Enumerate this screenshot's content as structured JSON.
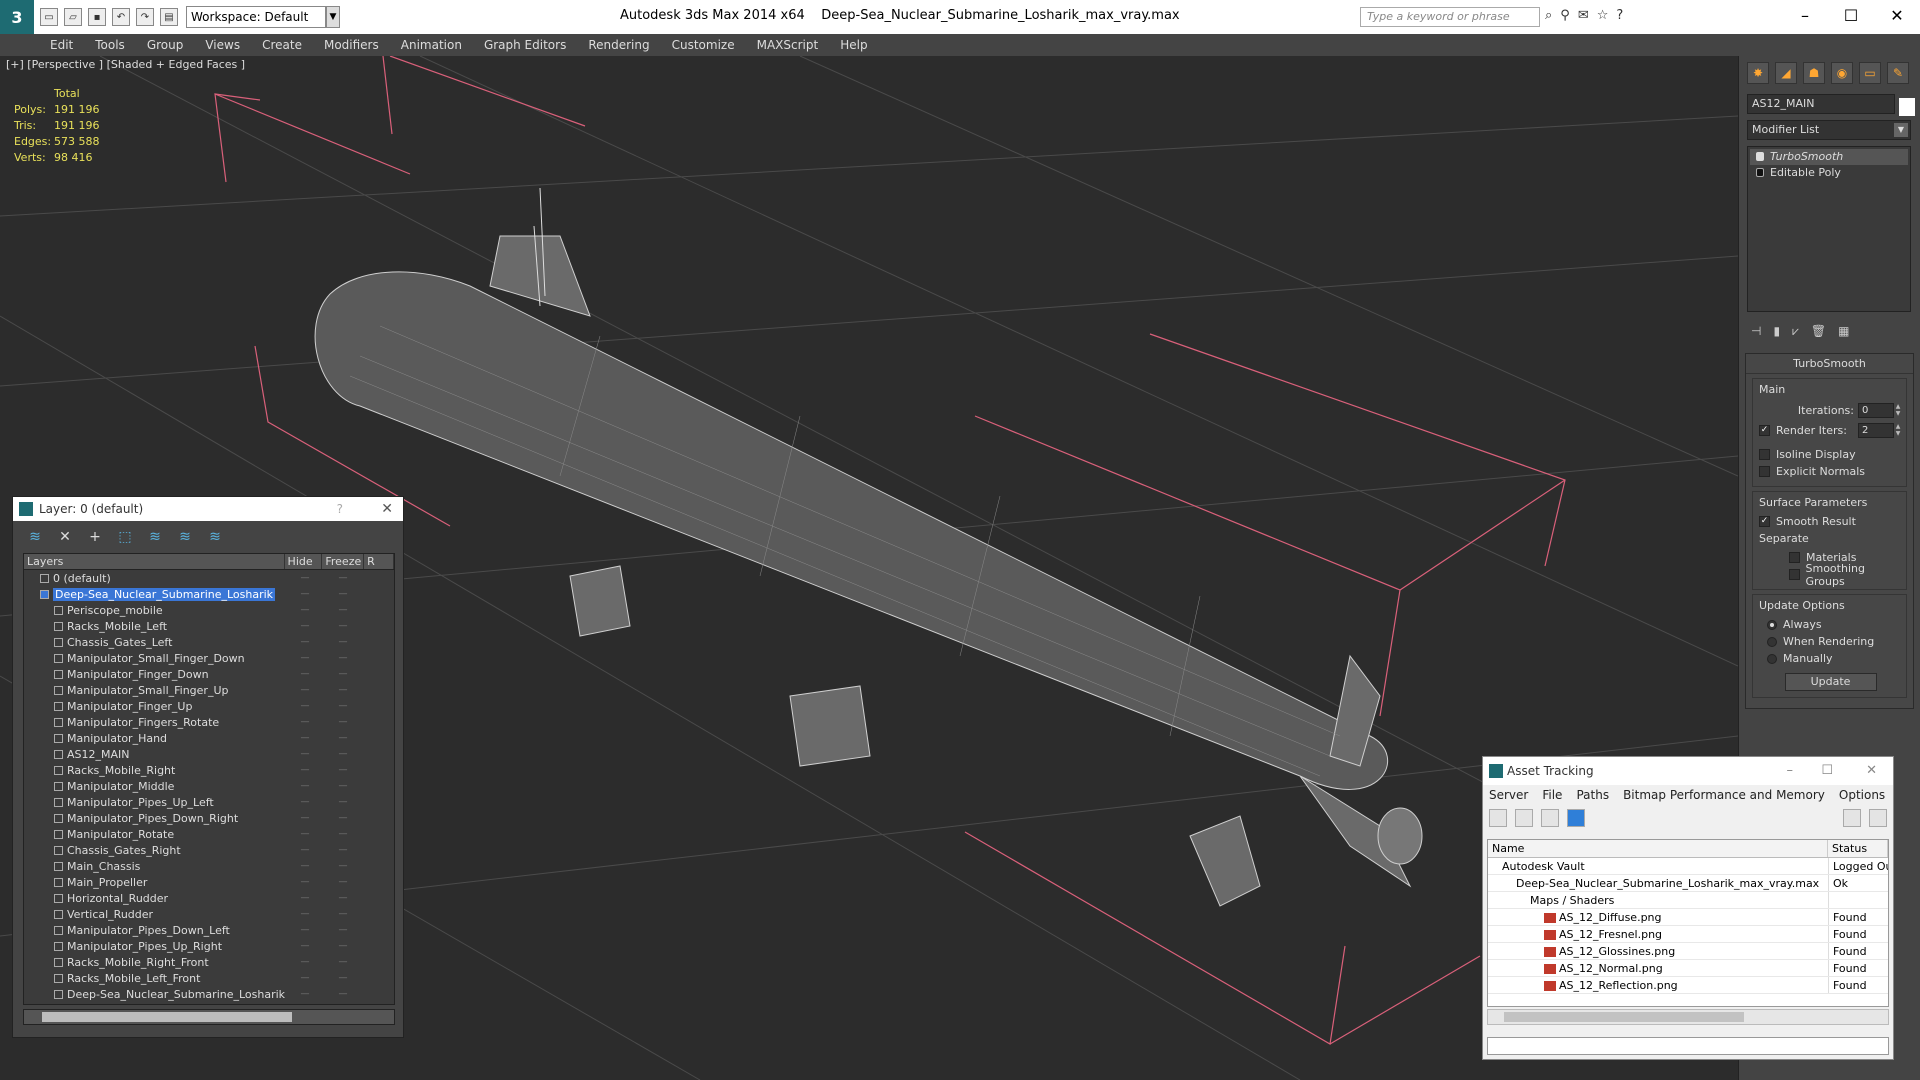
{
  "titlebar": {
    "workspace": "Workspace: Default",
    "app_title": "Autodesk 3ds Max  2014 x64",
    "file_title": "Deep-Sea_Nuclear_Submarine_Losharik_max_vray.max",
    "search_placeholder": "Type a keyword or phrase"
  },
  "menu": [
    "Edit",
    "Tools",
    "Group",
    "Views",
    "Create",
    "Modifiers",
    "Animation",
    "Graph Editors",
    "Rendering",
    "Customize",
    "MAXScript",
    "Help"
  ],
  "viewport": {
    "label": "[+] [Perspective ] [Shaded + Edged Faces ]",
    "stats_header": "Total",
    "stats": [
      {
        "k": "Polys:",
        "v": "191 196"
      },
      {
        "k": "Tris:",
        "v": "191 196"
      },
      {
        "k": "Edges:",
        "v": "573 588"
      },
      {
        "k": "Verts:",
        "v": "98 416"
      }
    ]
  },
  "cmdpanel": {
    "object_name": "AS12_MAIN",
    "modifier_list": "Modifier List",
    "stack": [
      "TurboSmooth",
      "Editable Poly"
    ],
    "turbosmooth": {
      "title": "TurboSmooth",
      "main": "Main",
      "iterations_label": "Iterations:",
      "iterations": "0",
      "render_iters_label": "Render Iters:",
      "render_iters": "2",
      "isoline": "Isoline Display",
      "explicit_normals": "Explicit Normals",
      "surface_params": "Surface Parameters",
      "smooth_result": "Smooth Result",
      "separate": "Separate",
      "materials": "Materials",
      "smoothing_groups": "Smoothing Groups",
      "update_options": "Update Options",
      "always": "Always",
      "when_rendering": "When Rendering",
      "manually": "Manually",
      "update_btn": "Update"
    }
  },
  "layer_dialog": {
    "title": "Layer: 0 (default)",
    "help": "?",
    "col_layers": "Layers",
    "col_hide": "Hide",
    "col_freeze": "Freeze",
    "col_r": "R",
    "rows": [
      {
        "name": "0 (default)",
        "level": 1
      },
      {
        "name": "Deep-Sea_Nuclear_Submarine_Losharik",
        "level": 1
      },
      {
        "name": "Periscope_mobile",
        "level": 2
      },
      {
        "name": "Racks_Mobile_Left",
        "level": 2
      },
      {
        "name": "Chassis_Gates_Left",
        "level": 2
      },
      {
        "name": "Manipulator_Small_Finger_Down",
        "level": 2
      },
      {
        "name": "Manipulator_Finger_Down",
        "level": 2
      },
      {
        "name": "Manipulator_Small_Finger_Up",
        "level": 2
      },
      {
        "name": "Manipulator_Finger_Up",
        "level": 2
      },
      {
        "name": "Manipulator_Fingers_Rotate",
        "level": 2
      },
      {
        "name": "Manipulator_Hand",
        "level": 2
      },
      {
        "name": "AS12_MAIN",
        "level": 2
      },
      {
        "name": "Racks_Mobile_Right",
        "level": 2
      },
      {
        "name": "Manipulator_Middle",
        "level": 2
      },
      {
        "name": "Manipulator_Pipes_Up_Left",
        "level": 2
      },
      {
        "name": "Manipulator_Pipes_Down_Right",
        "level": 2
      },
      {
        "name": "Manipulator_Rotate",
        "level": 2
      },
      {
        "name": "Chassis_Gates_Right",
        "level": 2
      },
      {
        "name": "Main_Chassis",
        "level": 2
      },
      {
        "name": "Main_Propeller",
        "level": 2
      },
      {
        "name": "Horizontal_Rudder",
        "level": 2
      },
      {
        "name": "Vertical_Rudder",
        "level": 2
      },
      {
        "name": "Manipulator_Pipes_Down_Left",
        "level": 2
      },
      {
        "name": "Manipulator_Pipes_Up_Right",
        "level": 2
      },
      {
        "name": "Racks_Mobile_Right_Front",
        "level": 2
      },
      {
        "name": "Racks_Mobile_Left_Front",
        "level": 2
      },
      {
        "name": "Deep-Sea_Nuclear_Submarine_Losharik",
        "level": 2
      }
    ]
  },
  "asset_tracking": {
    "title": "Asset Tracking",
    "menu": [
      "Server",
      "File",
      "Paths",
      "Bitmap Performance and Memory",
      "Options"
    ],
    "col_name": "Name",
    "col_status": "Status",
    "rows": [
      {
        "name": "Autodesk Vault",
        "status": "Logged Out",
        "level": 1
      },
      {
        "name": "Deep-Sea_Nuclear_Submarine_Losharik_max_vray.max",
        "status": "Ok",
        "level": 2
      },
      {
        "name": "Maps / Shaders",
        "status": "",
        "level": 3
      },
      {
        "name": "AS_12_Diffuse.png",
        "status": "Found",
        "level": 4
      },
      {
        "name": "AS_12_Fresnel.png",
        "status": "Found",
        "level": 4
      },
      {
        "name": "AS_12_Glossines.png",
        "status": "Found",
        "level": 4
      },
      {
        "name": "AS_12_Normal.png",
        "status": "Found",
        "level": 4
      },
      {
        "name": "AS_12_Reflection.png",
        "status": "Found",
        "level": 4
      }
    ]
  }
}
